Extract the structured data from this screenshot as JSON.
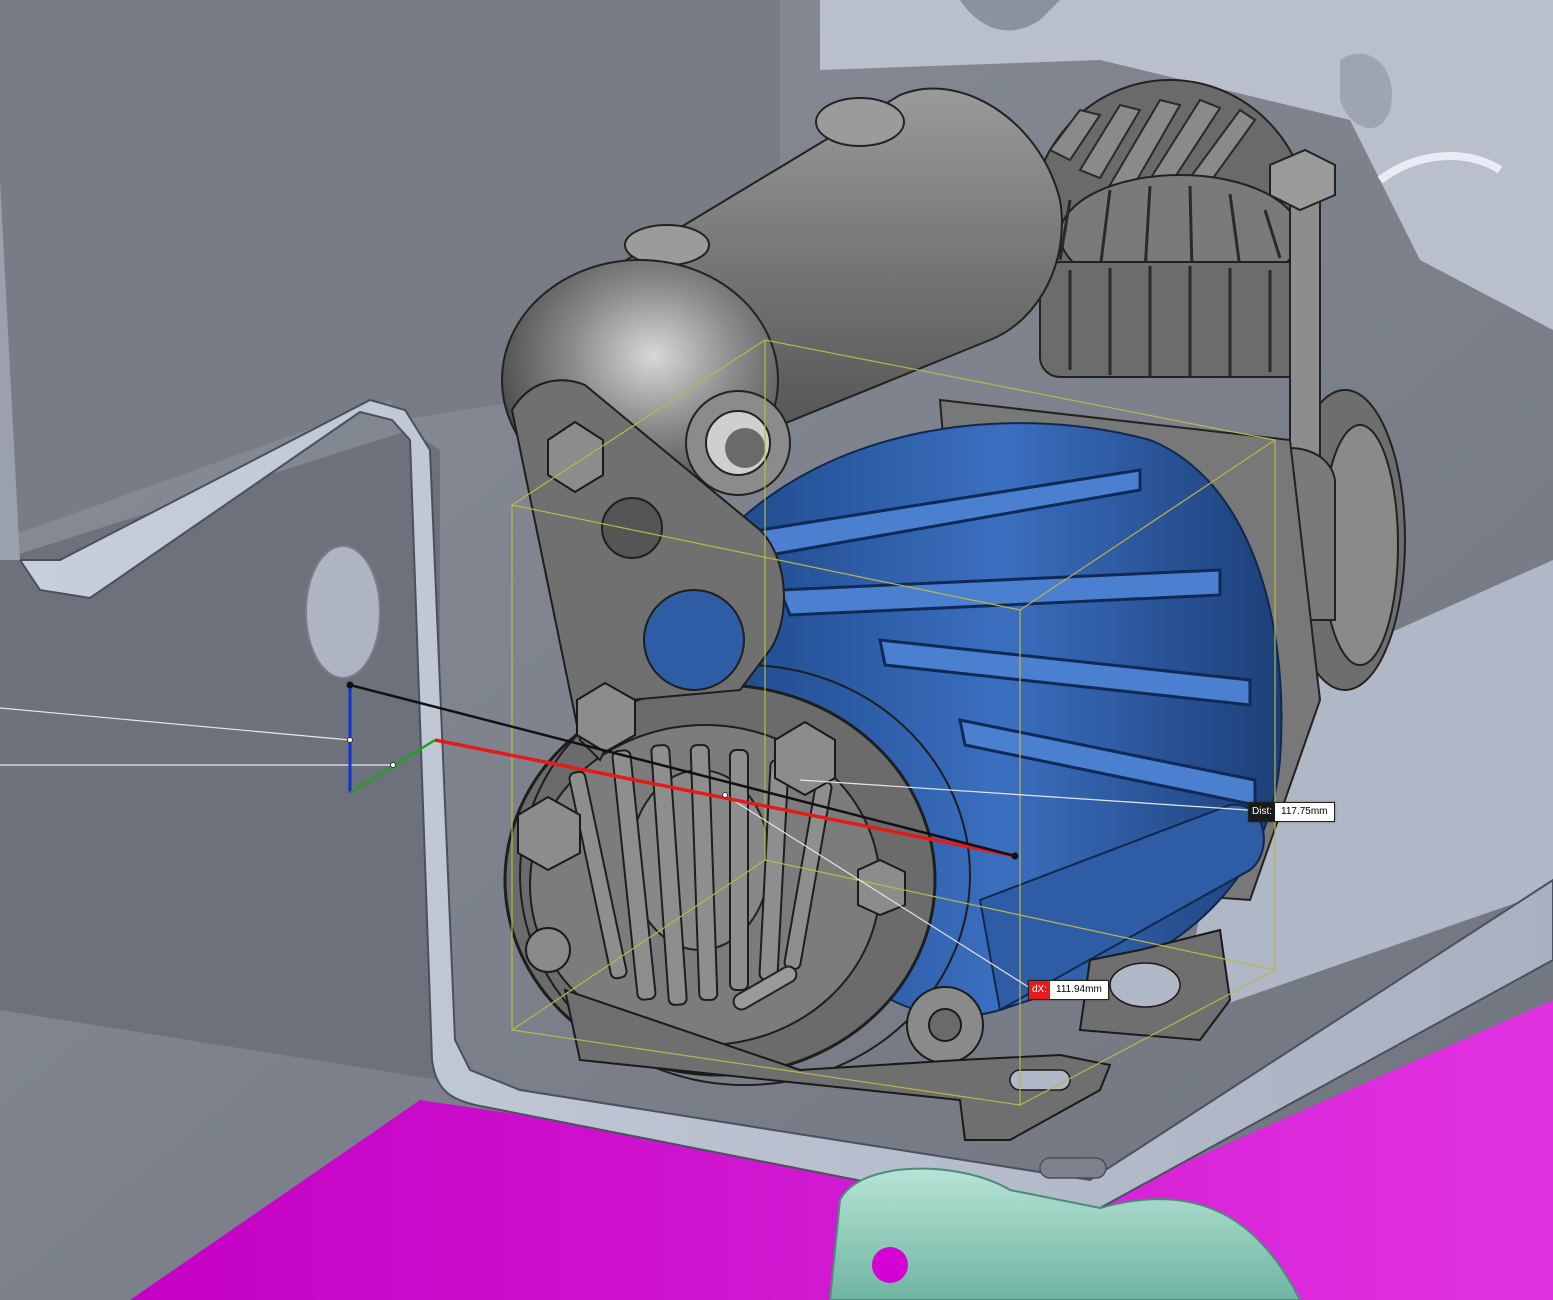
{
  "viewport": {
    "measure": {
      "distance_label": "Dist:",
      "distance_value": "117.75mm",
      "dx_label": "dX:",
      "dx_value": "111.94mm"
    },
    "colors": {
      "background_panel": "#7d828c",
      "bracket": "#b4bccc",
      "pump_body": "#6e6e6e",
      "motor_shell": "#2e5fa8",
      "floor_highlight": "#d400d4",
      "mount_plate": "#8fc9b8",
      "measure_line": "#111111",
      "dx_line": "#e31b1b",
      "bounding_box": "#b8b84a"
    },
    "icons": {
      "triad": "xyz-triad-icon",
      "measure_point": "measure-point-icon"
    }
  }
}
